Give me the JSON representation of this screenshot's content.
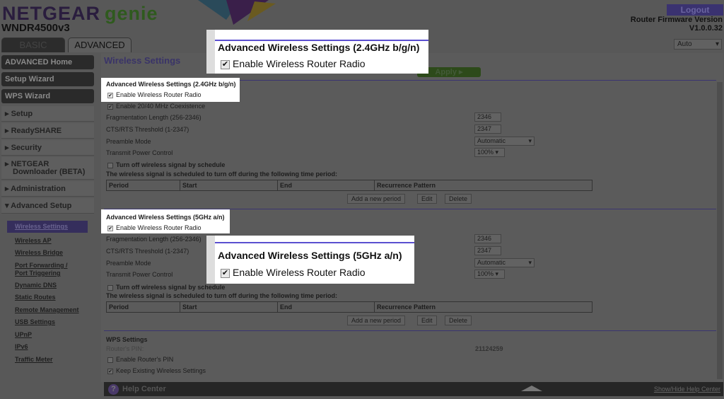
{
  "header": {
    "brand": "NETGEAR",
    "product": "genie",
    "model": "WNDR4500v3",
    "logout": "Logout",
    "firmware_label": "Router Firmware Version",
    "firmware_version": "V1.0.0.32",
    "language": "Auto"
  },
  "tabs": [
    {
      "label": "BASIC",
      "active": false
    },
    {
      "label": "ADVANCED",
      "active": true
    }
  ],
  "sidebar": {
    "buttons": [
      "ADVANCED Home",
      "Setup Wizard",
      "WPS Wizard"
    ],
    "sections": [
      "Setup",
      "ReadySHARE",
      "Security",
      "NETGEAR Downloader (BETA)",
      "Administration",
      "Advanced Setup"
    ],
    "subitems": [
      "Wireless Settings",
      "Wireless AP",
      "Wireless Bridge",
      "Port Forwarding / Port Triggering",
      "Dynamic DNS",
      "Static Routes",
      "Remote Management",
      "USB Settings",
      "UPnP",
      "IPv6",
      "Traffic Meter"
    ],
    "active": "Wireless Settings"
  },
  "main": {
    "title": "Wireless Settings",
    "apply": "Apply",
    "band24": {
      "heading": "Advanced Wireless Settings (2.4GHz b/g/n)",
      "enable_radio": "Enable Wireless Router Radio",
      "coexist": "Enable 20/40 MHz Coexistence",
      "frag_label": "Fragmentation Length (256-2346)",
      "frag": "2346",
      "cts_label": "CTS/RTS Threshold (1-2347)",
      "cts": "2347",
      "preamble_label": "Preamble Mode",
      "preamble": "Automatic",
      "power_label": "Transmit Power Control",
      "power": "100%",
      "schedule": "Turn off wireless signal by schedule",
      "schedule_note": "The wireless signal is scheduled to turn off during the following time period:"
    },
    "band5": {
      "heading": "Advanced Wireless Settings (5GHz a/n)",
      "enable_radio": "Enable Wireless Router Radio",
      "frag_label": "Fragmentation Length (256-2346)",
      "frag": "2346",
      "cts_label": "CTS/RTS Threshold (1-2347)",
      "cts": "2347",
      "preamble_label": "Preamble Mode",
      "preamble": "Automatic",
      "power_label": "Transmit Power Control",
      "power": "100%",
      "schedule": "Turn off wireless signal by schedule",
      "schedule_note": "The wireless signal is scheduled to turn off during the following time period:"
    },
    "table_headers": [
      "Period",
      "Start",
      "End",
      "Recurrence Pattern"
    ],
    "buttons": {
      "add": "Add a new period",
      "edit": "Edit",
      "delete": "Delete"
    },
    "wps": {
      "heading": "WPS Settings",
      "pin_label": "Router's PIN:",
      "pin": "21124259",
      "enable_pin": "Enable Router's PIN",
      "keep": "Keep Existing Wireless Settings"
    }
  },
  "help": {
    "label": "Help Center",
    "toggle": "Show/Hide Help Center"
  },
  "callouts": {
    "c24": {
      "heading": "Advanced Wireless Settings (2.4GHz b/g/n)",
      "enable": "Enable Wireless Router Radio"
    },
    "c5": {
      "heading": "Advanced Wireless Settings (5GHz a/n)",
      "enable": "Enable Wireless Router Radio"
    }
  }
}
